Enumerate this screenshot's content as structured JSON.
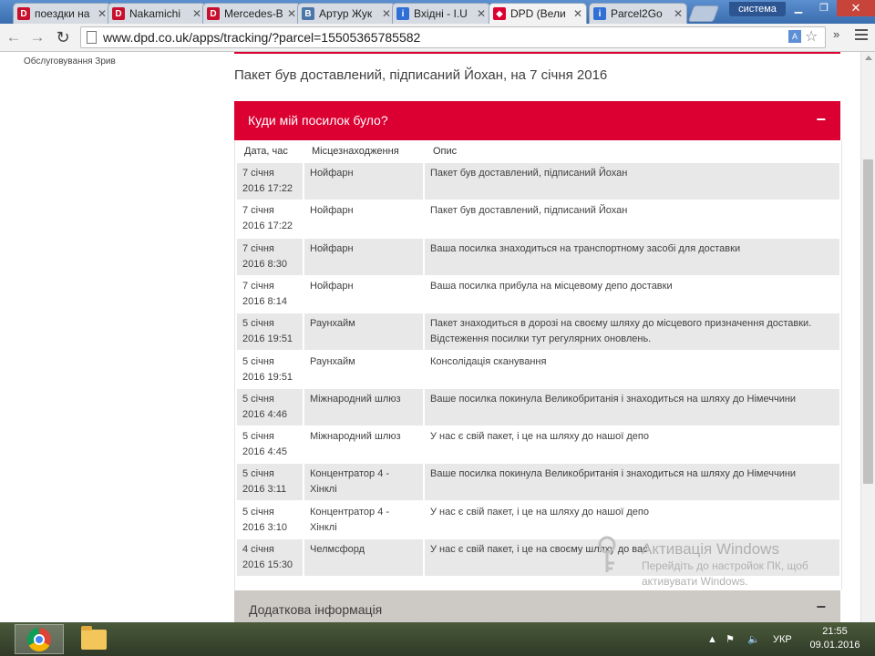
{
  "browser": {
    "tabs": [
      {
        "title": "поездки на",
        "favicon": "D",
        "color": "#c8102e",
        "active": false
      },
      {
        "title": "Nakamichi",
        "favicon": "D",
        "color": "#c8102e",
        "active": false
      },
      {
        "title": "Mercedes-B",
        "favicon": "D",
        "color": "#c8102e",
        "active": false
      },
      {
        "title": "Артур Жук",
        "favicon": "B",
        "color": "#4a76a8",
        "active": false
      },
      {
        "title": "Вхідні - I.U",
        "favicon": "i",
        "color": "#2f6fd6",
        "active": false
      },
      {
        "title": "DPD (Вели",
        "favicon": "◆",
        "color": "#dc0032",
        "active": true
      },
      {
        "title": "Parcel2Go",
        "favicon": "i",
        "color": "#2f6fd6",
        "active": false
      }
    ],
    "close_glyph": "✕",
    "user_label": "система",
    "url": "www.dpd.co.uk/apps/tracking/?parcel=15505365785582",
    "more_extensions": "»"
  },
  "page": {
    "left_link": "Обслуговування Зрив",
    "status": "Пакет був доставлений, підписаний Йохан, на 7 січня 2016",
    "tracking_panel": {
      "title": "Куди мій посилок було?",
      "toggle": "−",
      "headers": {
        "date": "Дата, час",
        "location": "Місцезнаходження",
        "description": "Опис"
      },
      "rows": [
        {
          "date": "7 січня",
          "time": "2016 17:22",
          "location": "Нойфарн",
          "description": "Пакет був доставлений, підписаний Йохан"
        },
        {
          "date": "7 січня",
          "time": "2016 17:22",
          "location": "Нойфарн",
          "description": "Пакет був доставлений, підписаний Йохан"
        },
        {
          "date": "7 січня",
          "time": "2016 8:30",
          "location": "Нойфарн",
          "description": "Ваша посилка знаходиться на транспортному засобі для доставки"
        },
        {
          "date": "7 січня",
          "time": "2016 8:14",
          "location": "Нойфарн",
          "description": "Ваша посилка прибула на місцевому депо доставки"
        },
        {
          "date": "5 січня",
          "time": "2016 19:51",
          "location": "Раунхайм",
          "description": "Пакет знаходиться в дорозі на своєму шляху до місцевого призначення доставки. Відстеження посилки тут регулярних оновлень."
        },
        {
          "date": "5 січня",
          "time": "2016 19:51",
          "location": "Раунхайм",
          "description": "Консолідація сканування"
        },
        {
          "date": "5 січня",
          "time": "2016 4:46",
          "location": "Міжнародний шлюз",
          "description": "Ваше посилка покинула Великобританія і знаходиться на шляху до Німеччини"
        },
        {
          "date": "5 січня",
          "time": "2016 4:45",
          "location": "Міжнародний шлюз",
          "description": "У нас є свій пакет, і це на шляху до нашої депо"
        },
        {
          "date": "5 січня",
          "time": "2016 3:11",
          "location": "Концентратор 4 - Хінклі",
          "description": "Ваше посилка покинула Великобританія і знаходиться на шляху до Німеччини"
        },
        {
          "date": "5 січня",
          "time": "2016 3:10",
          "location": "Концентратор 4 - Хінклі",
          "description": "У нас є свій пакет, і це на шляху до нашої депо"
        },
        {
          "date": "4 січня",
          "time": "2016 15:30",
          "location": "Челмсфорд",
          "description": "У нас є свій пакет, і це на своєму шляху до вас"
        }
      ]
    },
    "info_panel": {
      "title": "Додаткова інформація",
      "toggle": "−"
    },
    "watermark": {
      "title": "Активація Windows",
      "line1": "Перейдіть до настройок ПК, щоб",
      "line2": "активувати Windows."
    }
  },
  "taskbar": {
    "language": "УКР",
    "time": "21:55",
    "date": "09.01.2016"
  }
}
